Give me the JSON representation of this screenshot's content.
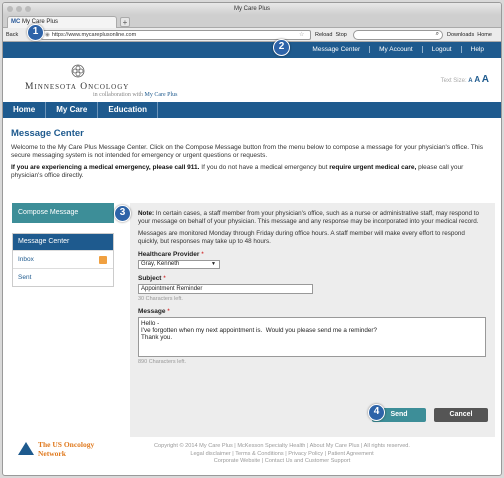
{
  "browser": {
    "window_title": "My Care Plus",
    "tab_favicon": "MC",
    "tab_title": "My Care Plus",
    "new_tab": "+",
    "back_label": "Back",
    "url": "https://www.mycareplusonline.com",
    "reload_label": "Reload",
    "stop_label": "Stop",
    "search_icon": "search-icon",
    "downloads_label": "Downloads",
    "home_label": "Home"
  },
  "topnav": {
    "items": [
      "Message Center",
      "My Account",
      "Logout",
      "Help"
    ]
  },
  "brand": {
    "name": "Minnesota Oncology",
    "subtitle_prefix": "in collaboration with",
    "subtitle_link": "My Care Plus",
    "text_size_label": "Text Size:",
    "text_size_options": [
      "A",
      "A",
      "A"
    ]
  },
  "mainnav": {
    "items": [
      "Home",
      "My Care",
      "Education"
    ]
  },
  "page": {
    "title": "Message Center",
    "intro": "Welcome to the My Care Plus Message Center. Click on the Compose Message button from the menu below to compose a message for your physician's office. This secure messaging system is not intended for emergency or urgent questions or requests.",
    "emergency_bold1": "If you are experiencing a medical emergency, please call 911.",
    "emergency_mid": " If you do not have a medical emergency but ",
    "emergency_bold2": "require urgent medical care,",
    "emergency_end": " please call your physician's office directly."
  },
  "sidebar": {
    "compose_label": "Compose Message",
    "header": "Message Center",
    "items": [
      "Inbox",
      "Sent"
    ]
  },
  "form": {
    "note_label": "Note:",
    "note_text": " In certain cases, a staff member from your physician's office, such as a nurse or administrative staff, may respond to your message on behalf of your physician. This message and any response may be incorporated into your medical record.",
    "hours_text": "Messages are monitored Monday through Friday during office hours. A staff member will make every effort to respond quickly, but responses may take up to 48 hours.",
    "provider_label": "Healthcare Provider",
    "provider_value": "Gray, Kenneth",
    "subject_label": "Subject",
    "subject_value": "Appointment Reminder",
    "subject_hint": "30 Characters left.",
    "message_label": "Message",
    "message_value": "Hello -\nI've forgotten when my next appointment is.  Would you please send me a reminder?\nThank you.",
    "message_hint": "890 Characters left.",
    "required_mark": "*",
    "send_label": "Send",
    "cancel_label": "Cancel"
  },
  "footer": {
    "logo_line1": "The US Oncology",
    "logo_line2": "Network",
    "line1": "Copyright © 2014 My Care Plus | McKesson Specialty Health | About My Care Plus | All rights reserved.",
    "line2": "Legal disclaimer | Terms & Conditions | Privacy Policy | Patient Agreement",
    "line3": "Corporate Website | Contact Us and Customer Support"
  },
  "callouts": [
    "1",
    "2",
    "3",
    "4"
  ],
  "colors": {
    "brand_blue": "#1e5a8e",
    "teal": "#3d8e98",
    "callout_blue": "#2d63a8",
    "accent_orange": "#e07a1f"
  }
}
